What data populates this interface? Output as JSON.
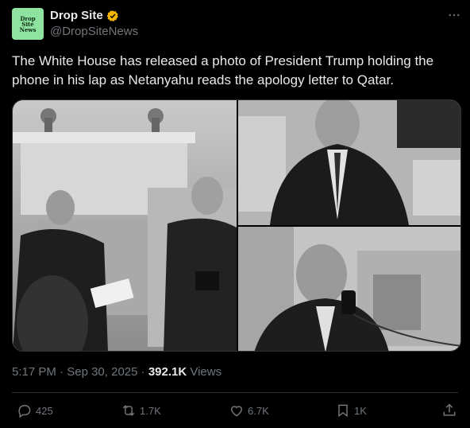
{
  "author": {
    "avatar_text": [
      "Drop",
      "Site",
      "News"
    ],
    "name": "Drop Site",
    "handle": "@DropSiteNews"
  },
  "more_icon": "more-horizontal-icon",
  "tweet_text": "The White House has released a photo of President Trump holding the phone in his lap as Netanyahu reads the apology letter to Qatar.",
  "meta": {
    "time": "5:17 PM",
    "sep1": " · ",
    "date": "Sep 30, 2025",
    "sep2": " · ",
    "views_count": "392.1K",
    "views_label": " Views"
  },
  "actions": {
    "replies": "425",
    "reposts": "1.7K",
    "likes": "6.7K",
    "bookmarks": "1K"
  },
  "colors": {
    "verified": "#f4b400",
    "avatar": "#8fe3a0",
    "muted": "#71767b"
  }
}
